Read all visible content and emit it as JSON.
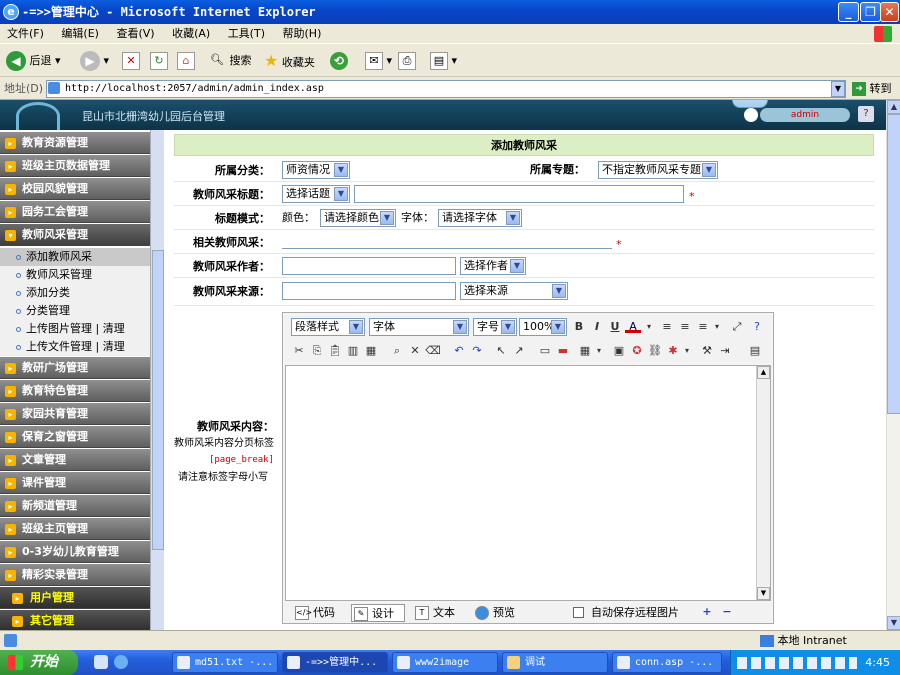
{
  "window": {
    "title": "-=>>管理中心 - Microsoft Internet Explorer"
  },
  "menu": [
    "文件(F)",
    "编辑(E)",
    "查看(V)",
    "收藏(A)",
    "工具(T)",
    "帮助(H)"
  ],
  "toolbar": {
    "back": "后退",
    "search": "搜索",
    "favorites": "收藏夹"
  },
  "address": {
    "label": "地址(D)",
    "url": "http://localhost:2057/admin/admin_index.asp",
    "go": "转到"
  },
  "banner": {
    "title": "昆山市北栅湾幼儿园后台管理",
    "user": "admin"
  },
  "sidebar": {
    "categories_top": [
      "教育资源管理",
      "班级主页数据管理",
      "校园风貌管理",
      "园务工会管理",
      "教师风采管理"
    ],
    "sub_items": [
      "添加教师风采",
      "教师风采管理",
      "添加分类",
      "分类管理",
      "上传图片管理 | 清理",
      "上传文件管理 | 清理"
    ],
    "categories_bottom": [
      "教研广场管理",
      "教育特色管理",
      "家园共育管理",
      "保育之窗管理",
      "文章管理",
      "课件管理",
      "新频道管理",
      "班级主页管理",
      "0-3岁幼儿教育管理",
      "精彩实录管理"
    ],
    "active_sections": [
      "用户管理",
      "其它管理"
    ]
  },
  "form": {
    "header": "添加教师风采",
    "category_label": "所属分类：",
    "category_value": "师资情况",
    "topic_label": "所属专题：",
    "topic_value": "不指定教师风采专题",
    "title_label": "教师风采标题：",
    "title_select": "选择话题",
    "style_label": "标题模式：",
    "color_label": "颜色：",
    "color_value": "请选择颜色",
    "font_label": "字体：",
    "font_value": "请选择字体",
    "related_label": "相关教师风采：",
    "author_label": "教师风采作者：",
    "author_select": "选择作者",
    "source_label": "教师风采来源：",
    "source_select": "选择来源",
    "content_label": "教师风采内容：",
    "content_note1": "教师风采内容分页标签",
    "content_tag": "[page_break]",
    "content_note2": "请注意标签字母小写",
    "required": "*"
  },
  "editor": {
    "paragraph": "段落样式",
    "font": "字体",
    "size": "字号",
    "zoom": "100%",
    "tabs": [
      "代码",
      "设计",
      "文本",
      "预览"
    ],
    "autosave": "自动保存远程图片"
  },
  "status": {
    "zone": "本地 Intranet"
  },
  "taskbar": {
    "start": "开始",
    "tasks": [
      "md51.txt -...",
      "-=>>管理中...",
      "www2image",
      "调试",
      "conn.asp -..."
    ],
    "clock": "4:45"
  }
}
